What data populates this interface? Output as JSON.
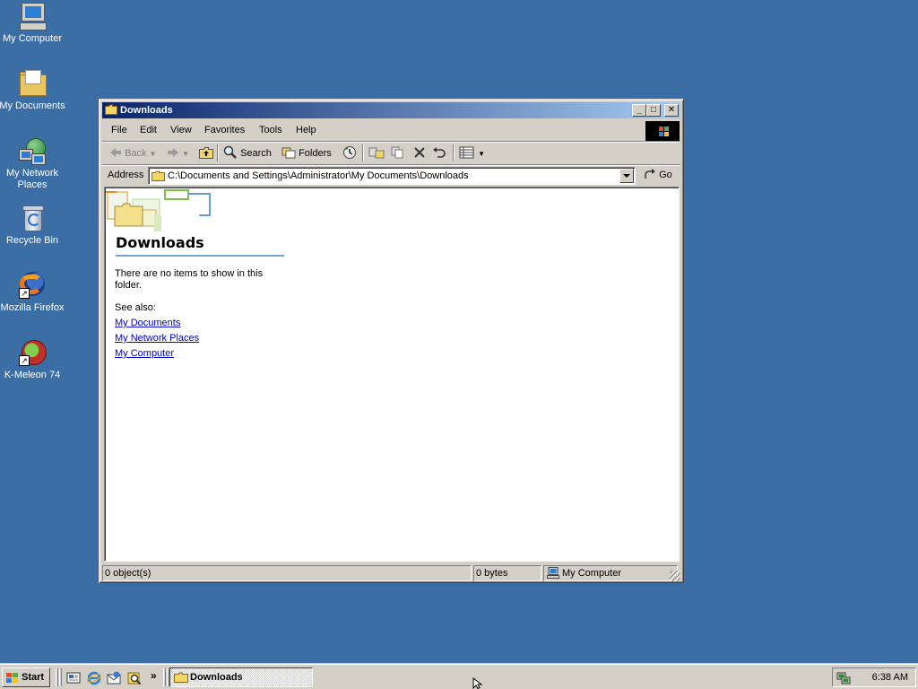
{
  "desktop": {
    "icons": [
      {
        "label": "My Computer",
        "icon": "computer-icon"
      },
      {
        "label": "My Documents",
        "icon": "folder-icon"
      },
      {
        "label": "My Network Places",
        "icon": "network-places-icon"
      },
      {
        "label": "Recycle Bin",
        "icon": "recycle-bin-icon"
      },
      {
        "label": "Mozilla Firefox",
        "icon": "firefox-icon"
      },
      {
        "label": "K-Meleon 74",
        "icon": "k-meleon-icon"
      }
    ]
  },
  "window": {
    "title": "Downloads",
    "caption_buttons": {
      "minimize": "_",
      "maximize": "□",
      "close": "✕"
    },
    "menu": [
      "File",
      "Edit",
      "View",
      "Favorites",
      "Tools",
      "Help"
    ],
    "toolbar": {
      "back": "Back",
      "forward_icon": "forward-arrow-icon",
      "up_icon": "up-folder-icon",
      "search": "Search",
      "folders": "Folders",
      "history_icon": "history-icon",
      "move_to_icon": "move-to-icon",
      "copy_to_icon": "copy-to-icon",
      "delete_icon": "delete-icon",
      "undo_icon": "undo-icon",
      "views_icon": "views-icon"
    },
    "address": {
      "label": "Address",
      "value": "C:\\Documents and Settings\\Administrator\\My Documents\\Downloads",
      "go": "Go"
    },
    "content": {
      "folder_title": "Downloads",
      "empty_message": "There are no items to show in this folder.",
      "see_also_label": "See also:",
      "links": [
        "My Documents",
        "My Network Places",
        "My Computer"
      ]
    },
    "status": {
      "objects": "0 object(s)",
      "size": "0 bytes",
      "zone": "My Computer"
    }
  },
  "taskbar": {
    "start_label": "Start",
    "quick_launch": [
      "show-desktop-icon",
      "internet-explorer-icon",
      "outlook-express-icon",
      "search-icon"
    ],
    "chevron": "»",
    "active_task": "Downloads",
    "clock": "6:38 AM"
  },
  "colors": {
    "desktop": "#3a6ea5",
    "title_start": "#0a246a",
    "title_end": "#a6caf0",
    "chrome": "#d4d0c8",
    "link": "#0000cc"
  }
}
